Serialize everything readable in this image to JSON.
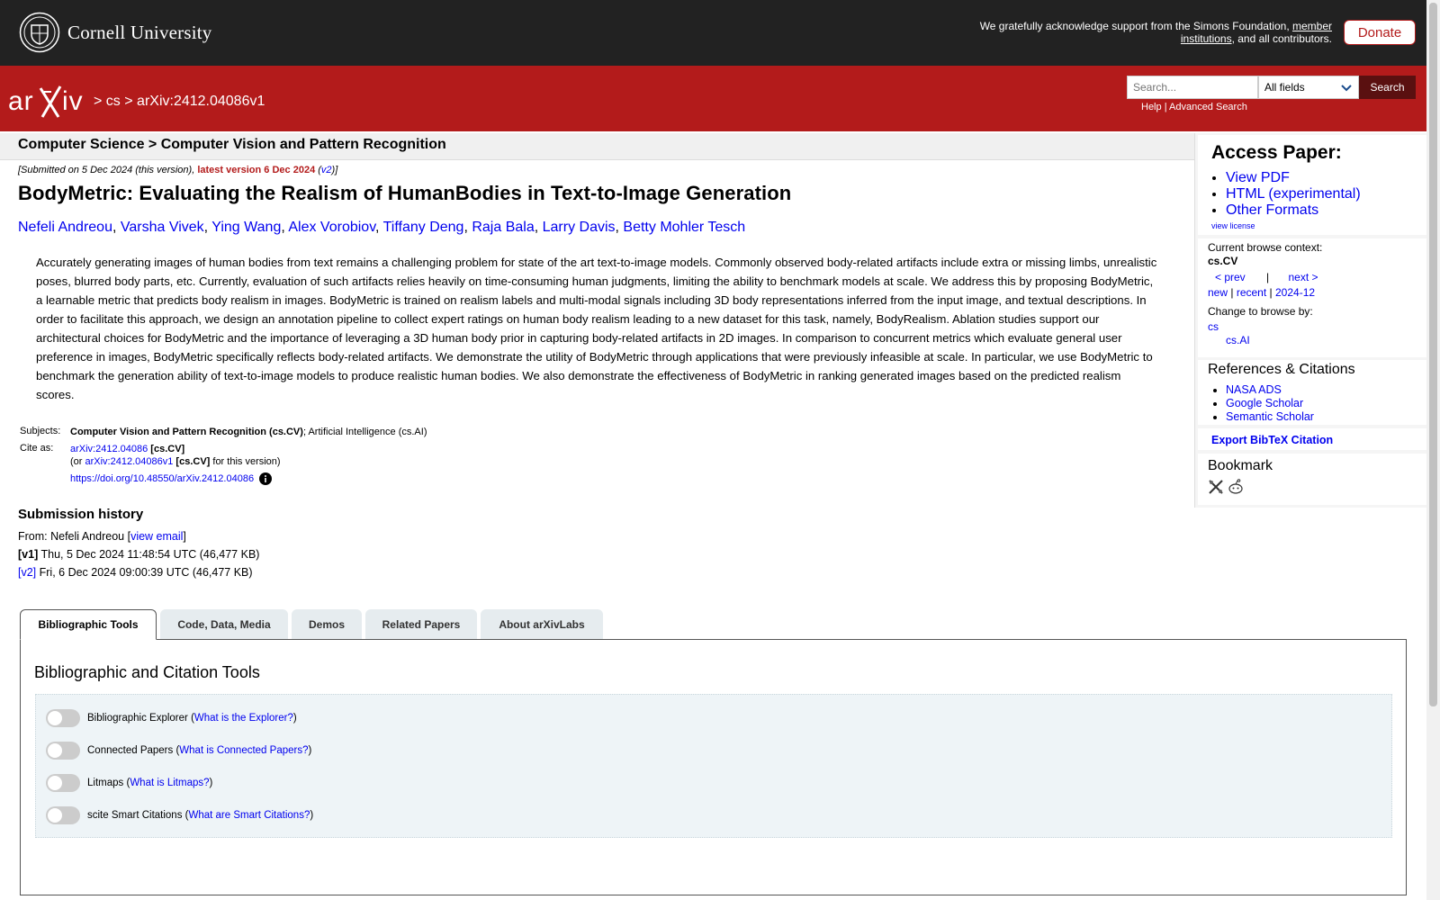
{
  "cornell": {
    "name": "Cornell University",
    "support_prefix": "We gratefully acknowledge support from the Simons Foundation, ",
    "support_link": "member institutions",
    "support_suffix": ", and all contributors.",
    "donate": "Donate"
  },
  "header": {
    "logo": "arXiv",
    "crumb_sep1": ">",
    "crumb_cs": "cs",
    "crumb_sep2": ">",
    "crumb_id": "arXiv:2412.04086v1",
    "search_placeholder": "Search...",
    "field_select": "All fields",
    "search_button": "Search",
    "help": "Help",
    "help_sep": "|",
    "advanced": "Advanced Search"
  },
  "category": "Computer Science > Computer Vision and Pattern Recognition",
  "paper": {
    "dateline_prefix": "[Submitted on 5 Dec 2024 (this version), ",
    "dateline_latest": "latest version 6 Dec 2024",
    "dateline_open": " (",
    "dateline_v2": "v2",
    "dateline_close": ")]",
    "title": "BodyMetric: Evaluating the Realism of HumanBodies in Text-to-Image Generation",
    "authors": [
      "Nefeli Andreou",
      "Varsha Vivek",
      "Ying Wang",
      "Alex Vorobiov",
      "Tiffany Deng",
      "Raja Bala",
      "Larry Davis",
      "Betty Mohler Tesch"
    ],
    "abstract": "Accurately generating images of human bodies from text remains a challenging problem for state of the art text-to-image models. Commonly observed body-related artifacts include extra or missing limbs, unrealistic poses, blurred body parts, etc. Currently, evaluation of such artifacts relies heavily on time-consuming human judgments, limiting the ability to benchmark models at scale. We address this by proposing BodyMetric, a learnable metric that predicts body realism in images. BodyMetric is trained on realism labels and multi-modal signals including 3D body representations inferred from the input image, and textual descriptions. In order to facilitate this approach, we design an annotation pipeline to collect expert ratings on human body realism leading to a new dataset for this task, namely, BodyRealism. Ablation studies support our architectural choices for BodyMetric and the importance of leveraging a 3D human body prior in capturing body-related artifacts in 2D images. In comparison to concurrent metrics which evaluate general user preference in images, BodyMetric specifically reflects body-related artifacts. We demonstrate the utility of BodyMetric through applications that were previously infeasible at scale. In particular, we use BodyMetric to benchmark the generation ability of text-to-image models to produce realistic human bodies. We also demonstrate the effectiveness of BodyMetric in ranking generated images based on the predicted realism scores.",
    "subjects_label": "Subjects:",
    "subjects_primary": "Computer Vision and Pattern Recognition (cs.CV)",
    "subjects_rest": "; Artificial Intelligence (cs.AI)",
    "cite_label": "Cite as:",
    "cite_id": "arXiv:2412.04086",
    "cite_cat": "[cs.CV]",
    "cite_or": "(or ",
    "cite_v1": "arXiv:2412.04086v1",
    "cite_v1_cat": "[cs.CV]",
    "cite_v1_suffix": " for this version)",
    "doi": "https://doi.org/10.48550/arXiv.2412.04086"
  },
  "history": {
    "title": "Submission history",
    "from_prefix": "From: Nefeli Andreou [",
    "view_email": "view email",
    "from_suffix": "]",
    "v1_label": "[v1]",
    "v1_text": " Thu, 5 Dec 2024 11:48:54 UTC (46,477 KB)",
    "v2_label": "[v2]",
    "v2_text": " Fri, 6 Dec 2024 09:00:39 UTC (46,477 KB)"
  },
  "tabs": [
    "Bibliographic Tools",
    "Code, Data, Media",
    "Demos",
    "Related Papers",
    "About arXivLabs"
  ],
  "panel": {
    "title": "Bibliographic and Citation Tools",
    "tools": [
      {
        "name": "Bibliographic Explorer",
        "link": "What is the Explorer?"
      },
      {
        "name": "Connected Papers",
        "link": "What is Connected Papers?"
      },
      {
        "name": "Litmaps",
        "link": "What is Litmaps?"
      },
      {
        "name": "scite Smart Citations",
        "link": "What are Smart Citations?"
      }
    ]
  },
  "sidebar": {
    "access_title": "Access Paper:",
    "access_links": [
      "View PDF",
      "HTML (experimental)",
      "Other Formats"
    ],
    "view_license": "view license",
    "browse_label": "Current browse context:",
    "browse_ctx": "cs.CV",
    "prev": "< prev",
    "sep": "|",
    "next": "next >",
    "new": "new",
    "recent": "recent",
    "month": "2024-12",
    "change_label": "Change to browse by:",
    "cs": "cs",
    "csai": "cs.AI",
    "refs_title": "References & Citations",
    "refs": [
      "NASA ADS",
      "Google Scholar",
      "Semantic Scholar"
    ],
    "export": "Export BibTeX Citation",
    "bookmark": "Bookmark"
  },
  "colors": {
    "arxiv_red": "#b31b1b",
    "link": "#0000ee",
    "cornell_bar": "#222222"
  }
}
